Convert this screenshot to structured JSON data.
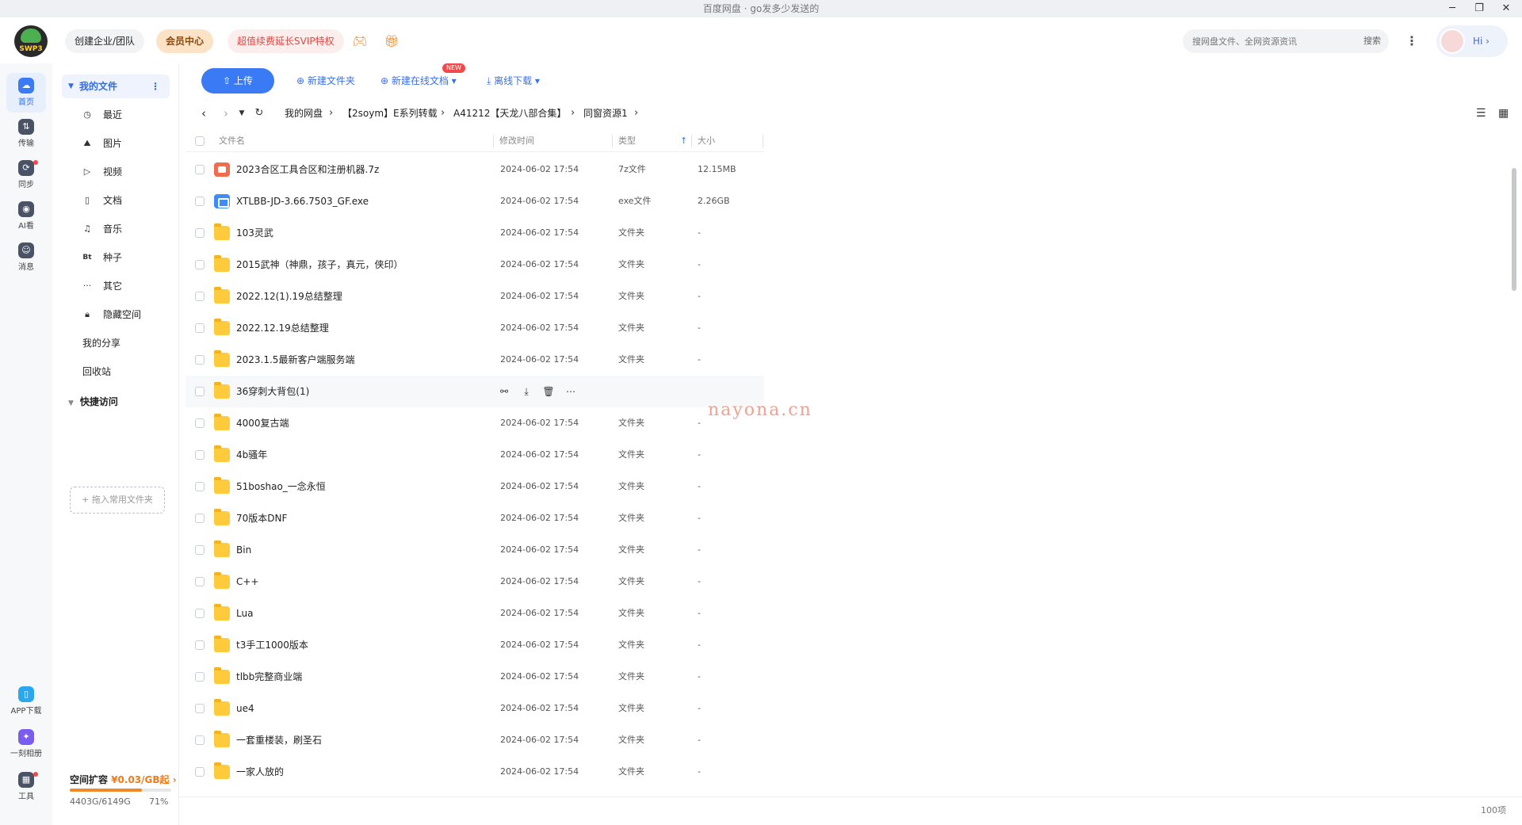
{
  "window": {
    "title": "百度网盘 · go发多少发送的"
  },
  "header": {
    "logo_text": "SWP3",
    "biz_label": "创建企业/团队",
    "vip_label": "会员中心",
    "svip_label": "超值续费延长SVIP特权",
    "search_placeholder": "搜网盘文件、全网资源资讯",
    "search_label": "搜索",
    "more_glyph": "⋮",
    "hi_label": "Hi ›"
  },
  "rail": {
    "items": [
      {
        "label": "首页",
        "icon": "home-icon"
      },
      {
        "label": "传输",
        "icon": "transfer-icon"
      },
      {
        "label": "同步",
        "icon": "sync-icon"
      },
      {
        "label": "AI看",
        "icon": "ai-icon"
      },
      {
        "label": "消息",
        "icon": "message-icon"
      }
    ],
    "bottom": [
      {
        "label": "APP下载",
        "icon": "phone-icon"
      },
      {
        "label": "一刻相册",
        "icon": "album-icon"
      },
      {
        "label": "工具",
        "icon": "tools-icon"
      }
    ]
  },
  "sidebar": {
    "my_files": "我的文件",
    "items": [
      {
        "label": "最近",
        "glyph": "◷"
      },
      {
        "label": "图片",
        "glyph": "⛰"
      },
      {
        "label": "视频",
        "glyph": "▷"
      },
      {
        "label": "文档",
        "glyph": "▯"
      },
      {
        "label": "音乐",
        "glyph": "♫"
      },
      {
        "label": "种子",
        "glyph": "Bt"
      },
      {
        "label": "其它",
        "glyph": "···"
      },
      {
        "label": "隐藏空间",
        "glyph": "🔒︎"
      }
    ],
    "my_share": "我的分享",
    "recycle": "回收站",
    "quick_access": "快捷访问",
    "drop_hint": "+ 拖入常用文件夹",
    "quota_title": "空间扩容",
    "quota_price": "¥0.03/GB起 ›",
    "quota_used": "4403G/6149G",
    "quota_pct": "71%",
    "quota_fraction": 0.71
  },
  "toolbar": {
    "upload": "⇧ 上传",
    "new_folder": "⊕ 新建文件夹",
    "new_doc": "⊕ 新建在线文档 ▾",
    "new_badge": "NEW",
    "offline": "⤓ 离线下载 ▾"
  },
  "breadcrumb": {
    "items": [
      "我的网盘",
      "【2soym】E系列转载",
      "A41212【天龙八部合集】",
      "同窗资源1"
    ]
  },
  "table": {
    "headers": {
      "name": "文件名",
      "modified": "修改时间",
      "type": "类型",
      "size": "大小",
      "sort_arrow": "↑"
    },
    "rows": [
      {
        "name": "2023合区工具合区和注册机器.7z",
        "date": "2024-06-02 17:54",
        "type": "7z文件",
        "size": "12.15MB",
        "icon": "archive"
      },
      {
        "name": "XTLBB-JD-3.66.7503_GF.exe",
        "date": "2024-06-02 17:54",
        "type": "exe文件",
        "size": "2.26GB",
        "icon": "exe"
      },
      {
        "name": "103灵武",
        "date": "2024-06-02 17:54",
        "type": "文件夹",
        "size": "-",
        "icon": "folder"
      },
      {
        "name": "2015武神（神鼎，孩子，真元，侠印）",
        "date": "2024-06-02 17:54",
        "type": "文件夹",
        "size": "-",
        "icon": "folder"
      },
      {
        "name": "2022.12(1).19总结整理",
        "date": "2024-06-02 17:54",
        "type": "文件夹",
        "size": "-",
        "icon": "folder"
      },
      {
        "name": "2022.12.19总结整理",
        "date": "2024-06-02 17:54",
        "type": "文件夹",
        "size": "-",
        "icon": "folder"
      },
      {
        "name": "2023.1.5最新客户端服务端",
        "date": "2024-06-02 17:54",
        "type": "文件夹",
        "size": "-",
        "icon": "folder"
      },
      {
        "name": "36穿刺大背包(1)",
        "date": "",
        "type": "",
        "size": "",
        "icon": "folder",
        "hover": true
      },
      {
        "name": "4000复古端",
        "date": "2024-06-02 17:54",
        "type": "文件夹",
        "size": "-",
        "icon": "folder"
      },
      {
        "name": "4b骚年",
        "date": "2024-06-02 17:54",
        "type": "文件夹",
        "size": "-",
        "icon": "folder"
      },
      {
        "name": "51boshao_一念永恒",
        "date": "2024-06-02 17:54",
        "type": "文件夹",
        "size": "-",
        "icon": "folder"
      },
      {
        "name": "70版本DNF",
        "date": "2024-06-02 17:54",
        "type": "文件夹",
        "size": "-",
        "icon": "folder"
      },
      {
        "name": "Bin",
        "date": "2024-06-02 17:54",
        "type": "文件夹",
        "size": "-",
        "icon": "folder"
      },
      {
        "name": "C++",
        "date": "2024-06-02 17:54",
        "type": "文件夹",
        "size": "-",
        "icon": "folder"
      },
      {
        "name": "Lua",
        "date": "2024-06-02 17:54",
        "type": "文件夹",
        "size": "-",
        "icon": "folder"
      },
      {
        "name": "t3手工1000版本",
        "date": "2024-06-02 17:54",
        "type": "文件夹",
        "size": "-",
        "icon": "folder"
      },
      {
        "name": "tlbb完整商业端",
        "date": "2024-06-02 17:54",
        "type": "文件夹",
        "size": "-",
        "icon": "folder"
      },
      {
        "name": "ue4",
        "date": "2024-06-02 17:54",
        "type": "文件夹",
        "size": "-",
        "icon": "folder"
      },
      {
        "name": "一套重楼装，刷圣石",
        "date": "2024-06-02 17:54",
        "type": "文件夹",
        "size": "-",
        "icon": "folder"
      },
      {
        "name": "一家人放的",
        "date": "2024-06-02 17:54",
        "type": "文件夹",
        "size": "-",
        "icon": "folder"
      }
    ]
  },
  "watermark": "nayona.cn",
  "footer": {
    "count": "100项"
  }
}
